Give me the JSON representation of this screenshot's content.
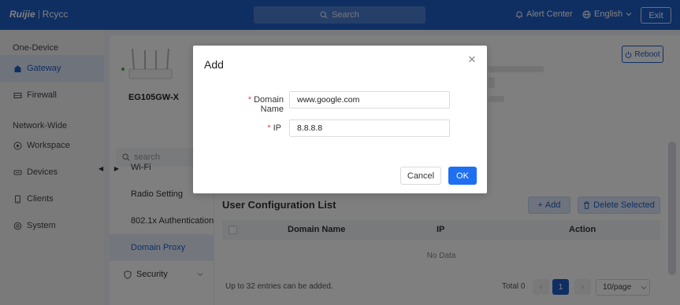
{
  "topbar": {
    "brand": "Ruijie",
    "product": "Rcycc",
    "search_label": "Search",
    "alert_center": "Alert Center",
    "language": "English",
    "exit": "Exit"
  },
  "sidebar": {
    "section_one_device": "One-Device",
    "section_network_wide": "Network-Wide",
    "items": [
      {
        "label": "Gateway",
        "icon": "gateway-icon"
      },
      {
        "label": "Firewall",
        "icon": "firewall-icon"
      },
      {
        "label": "Workspace",
        "icon": "workspace-icon"
      },
      {
        "label": "Devices",
        "icon": "devices-icon"
      },
      {
        "label": "Clients",
        "icon": "clients-icon"
      },
      {
        "label": "System",
        "icon": "system-icon"
      }
    ]
  },
  "device": {
    "name": "EG105GW-X",
    "reboot": "Reboot"
  },
  "submenu": {
    "search_placeholder": "search",
    "items": [
      {
        "label": "Wi-Fi"
      },
      {
        "label": "Radio Setting"
      },
      {
        "label": "802.1x Authentication"
      },
      {
        "label": "Domain Proxy"
      },
      {
        "label": "Security"
      }
    ]
  },
  "content": {
    "list_title": "User Configuration List",
    "add_label": "Add",
    "delete_selected_label": "Delete Selected",
    "columns": [
      "Domain Name",
      "IP",
      "Action"
    ],
    "no_data": "No Data",
    "footer_note": "Up to 32 entries can be added.",
    "total_label": "Total 0",
    "current_page": "1",
    "page_size": "10/page"
  },
  "modal": {
    "title": "Add",
    "fields": [
      {
        "label": "Domain Name",
        "value": "www.google.com",
        "required": true
      },
      {
        "label": "IP",
        "value": "8.8.8.8",
        "required": true
      }
    ],
    "required_marker": "*",
    "cancel": "Cancel",
    "ok": "OK"
  },
  "colors": {
    "primary": "#1f5ec7",
    "ok_button": "#1f6ff2",
    "required": "#e54545",
    "online": "#3bb34a"
  }
}
